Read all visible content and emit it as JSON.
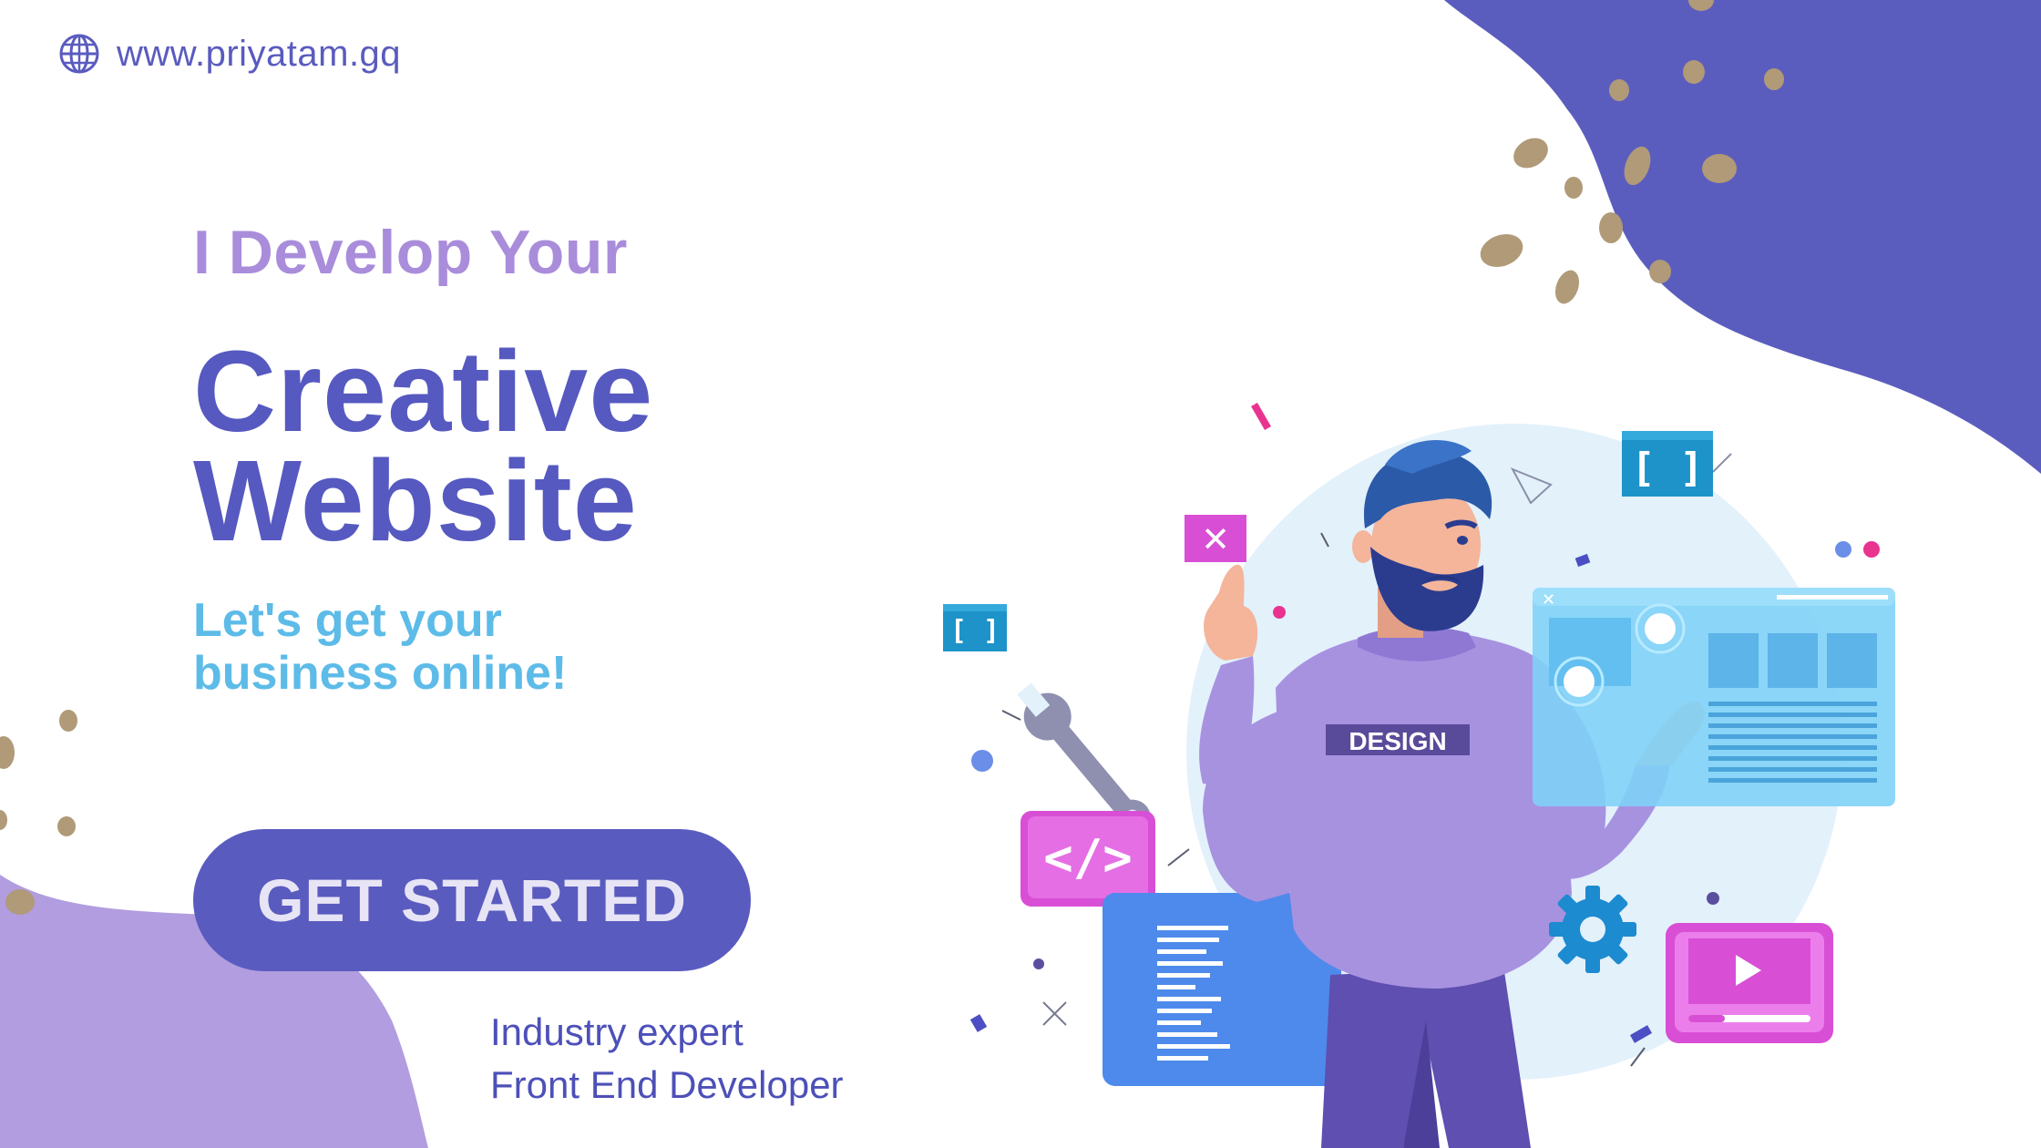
{
  "header": {
    "url": "www.priyatam.gq",
    "icon": "globe-icon"
  },
  "hero": {
    "eyebrow": "I Develop Your",
    "headline_line1": "Creative",
    "headline_line2": "Website",
    "subline_line1": "Let's get your",
    "subline_line2": "business online!",
    "cta_label": "GET STARTED",
    "tag_line1": "Industry expert",
    "tag_line2": "Front End Developer"
  },
  "illustration": {
    "shirt_text": "DESIGN",
    "bracket_text": "[ ]",
    "code_text": "</>",
    "close_text": "✕"
  },
  "colors": {
    "primary": "#5a5bbf",
    "eyebrow": "#a98ddb",
    "subline": "#5dbbe8",
    "blob_blue": "#5b5dbe",
    "blob_lilac": "#b19ddf",
    "dots": "#b09a78"
  }
}
